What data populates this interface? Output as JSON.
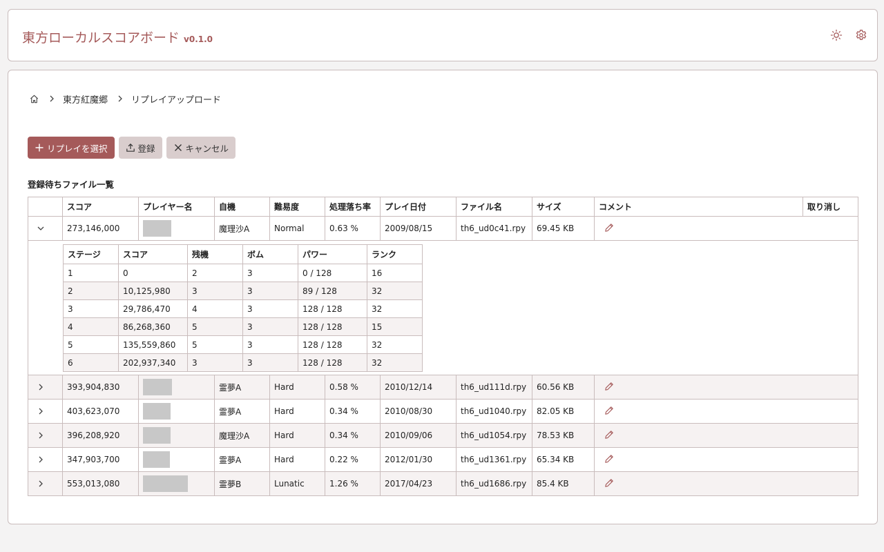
{
  "app": {
    "title": "東方ローカルスコアボード",
    "version": "v0.1.0"
  },
  "header_icons": [
    "sun-icon",
    "gear-icon"
  ],
  "breadcrumb": {
    "items": [
      "東方紅魔郷",
      "リプレイアップロード"
    ]
  },
  "toolbar": {
    "select_label": "リプレイを選択",
    "register_label": "登録",
    "cancel_label": "キャンセル"
  },
  "section": {
    "title": "登録待ちファイル一覧"
  },
  "table": {
    "headers": [
      "スコア",
      "プレイヤー名",
      "自機",
      "難易度",
      "処理落ち率",
      "プレイ日付",
      "ファイル名",
      "サイズ",
      "コメント",
      "取り消し"
    ],
    "rows": [
      {
        "score": "273,146,000",
        "player_blur": 0.63,
        "character": "魔理沙A",
        "difficulty": "Normal",
        "slowdown": "0.63 %",
        "date": "2009/08/15",
        "file": "th6_ud0c41.rpy",
        "size": "69.45 KB",
        "expanded": true
      },
      {
        "score": "393,904,830",
        "player_blur": 0.65,
        "character": "霊夢A",
        "difficulty": "Hard",
        "slowdown": "0.58 %",
        "date": "2010/12/14",
        "file": "th6_ud111d.rpy",
        "size": "60.56 KB",
        "expanded": false
      },
      {
        "score": "403,623,070",
        "player_blur": 0.62,
        "character": "霊夢A",
        "difficulty": "Hard",
        "slowdown": "0.34 %",
        "date": "2010/08/30",
        "file": "th6_ud1040.rpy",
        "size": "82.05 KB",
        "expanded": false
      },
      {
        "score": "396,208,920",
        "player_blur": 0.62,
        "character": "魔理沙A",
        "difficulty": "Hard",
        "slowdown": "0.34 %",
        "date": "2010/09/06",
        "file": "th6_ud1054.rpy",
        "size": "78.53 KB",
        "expanded": false
      },
      {
        "score": "347,903,700",
        "player_blur": 0.6,
        "character": "霊夢A",
        "difficulty": "Hard",
        "slowdown": "0.22 %",
        "date": "2012/01/30",
        "file": "th6_ud1361.rpy",
        "size": "65.34 KB",
        "expanded": false
      },
      {
        "score": "553,013,080",
        "player_blur": 1.0,
        "character": "霊夢B",
        "difficulty": "Lunatic",
        "slowdown": "1.26 %",
        "date": "2017/04/23",
        "file": "th6_ud1686.rpy",
        "size": "85.4 KB",
        "expanded": false
      }
    ]
  },
  "stage_table": {
    "headers": [
      "ステージ",
      "スコア",
      "残機",
      "ボム",
      "パワー",
      "ランク"
    ],
    "rows": [
      [
        "1",
        "0",
        "2",
        "3",
        "0 / 128",
        "16"
      ],
      [
        "2",
        "10,125,980",
        "3",
        "3",
        "89 / 128",
        "32"
      ],
      [
        "3",
        "29,786,470",
        "4",
        "3",
        "128 / 128",
        "32"
      ],
      [
        "4",
        "86,268,360",
        "5",
        "3",
        "128 / 128",
        "15"
      ],
      [
        "5",
        "135,559,860",
        "5",
        "3",
        "128 / 128",
        "32"
      ],
      [
        "6",
        "202,937,340",
        "3",
        "3",
        "128 / 128",
        "32"
      ]
    ]
  },
  "colors": {
    "accent": "#a55a5a",
    "secondary_button": "#d9cdcd",
    "border": "#c9bcbc",
    "row_alt": "#f6f2f2",
    "redacted": "#c8c8c8"
  }
}
